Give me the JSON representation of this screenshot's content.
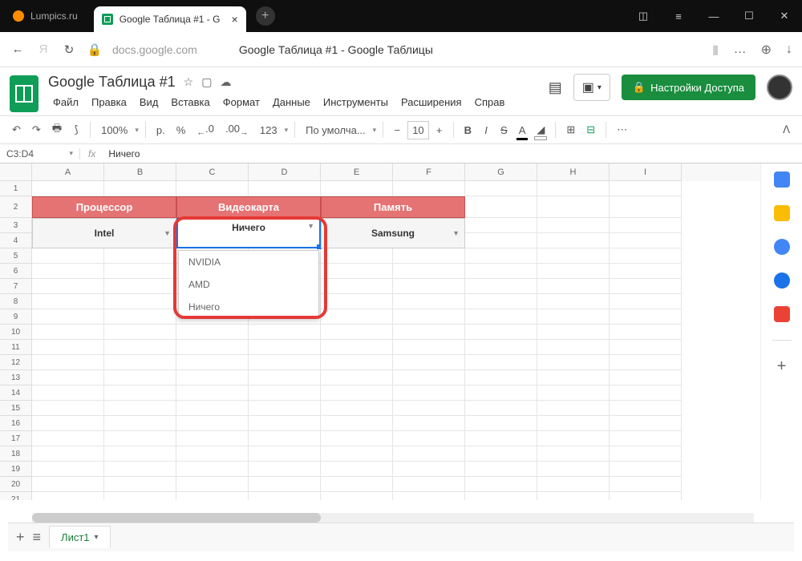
{
  "browser": {
    "tab_inactive": "Lumpics.ru",
    "tab_active": "Google Таблица #1 - G",
    "address_domain": "docs.google.com",
    "address_title": "Google Таблица #1 - Google Таблицы"
  },
  "doc": {
    "title": "Google Таблица #1",
    "menus": [
      "Файл",
      "Правка",
      "Вид",
      "Вставка",
      "Формат",
      "Данные",
      "Инструменты",
      "Расширения",
      "Справ"
    ],
    "share_label": "Настройки Доступа"
  },
  "toolbar": {
    "zoom": "100%",
    "currency": "р.",
    "percent": "%",
    "dec_dec": ".0",
    "dec_inc": ".00",
    "format": "123",
    "font": "По умолча...",
    "font_size": "10",
    "bold": "B",
    "italic": "I",
    "strike": "S",
    "text_color": "A"
  },
  "formula": {
    "range": "C3:D4",
    "fx": "fx",
    "value": "Ничего"
  },
  "columns": [
    "A",
    "B",
    "C",
    "D",
    "E",
    "F",
    "G",
    "H",
    "I"
  ],
  "rows": [
    "1",
    "2",
    "3",
    "4",
    "5",
    "6",
    "7",
    "8",
    "9",
    "10",
    "11",
    "12",
    "13",
    "14",
    "15",
    "16",
    "17",
    "18",
    "19",
    "20",
    "21"
  ],
  "table": {
    "header1": "Процессор",
    "header2": "Видеокарта",
    "header3": "Память",
    "val1": "Intel",
    "val2": "Ничего",
    "val3": "Samsung"
  },
  "dropdown": {
    "options": [
      "NVIDIA",
      "AMD",
      "Ничего"
    ]
  },
  "sheets": {
    "tab1": "Лист1"
  }
}
